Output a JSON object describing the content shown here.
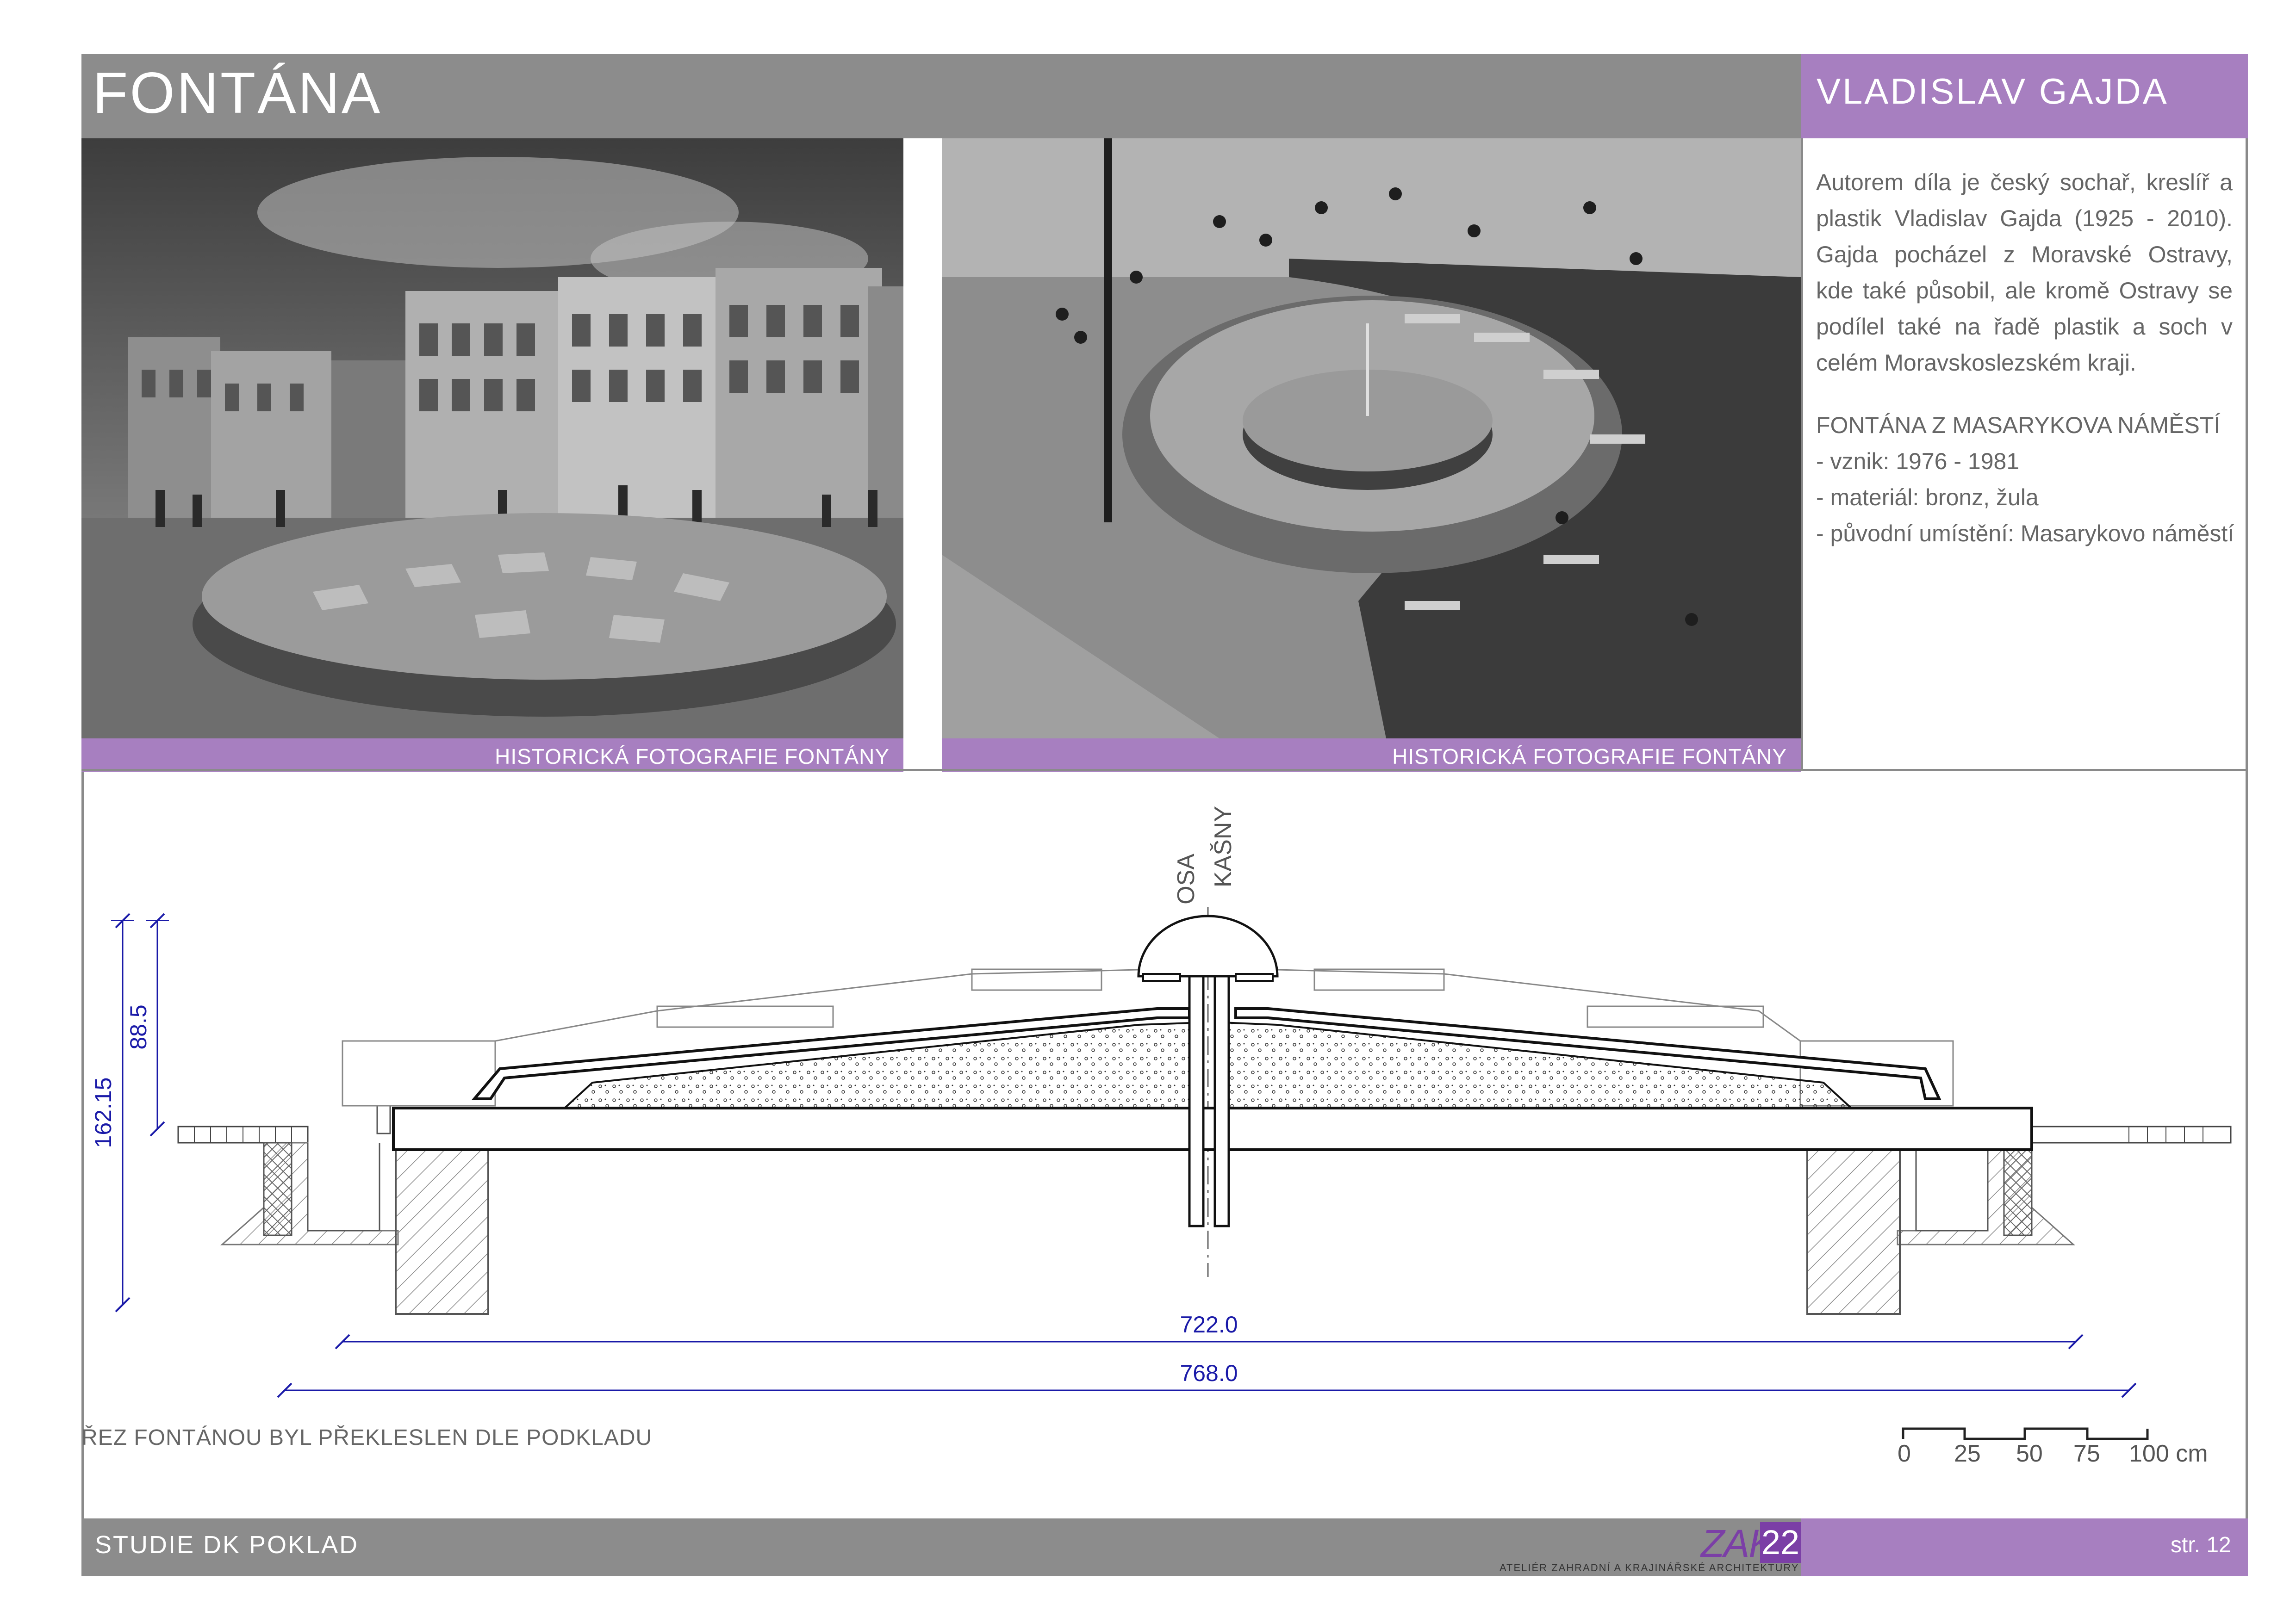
{
  "header": {
    "title": "FONTÁNA",
    "author": "VLADISLAV GAJDA"
  },
  "photos": [
    {
      "caption": "HISTORICKÁ FOTOGRAFIE FONTÁNY"
    },
    {
      "caption": "HISTORICKÁ FOTOGRAFIE FONTÁNY"
    }
  ],
  "side_panel": {
    "bio": "Autorem díla je český sochař, kreslíř a plastik Vladislav Gajda (1925 - 2010). Gajda pocházel z Moravské Ostravy, kde také působil, ale kromě Ostravy se podílel také na řadě plastik a soch v celém Moravskoslezském kraji.",
    "facts_title": "FONTÁNA Z MASARYKOVA NÁMĚSTÍ",
    "facts": [
      "- vznik: 1976 - 1981",
      "- materiál: bronz, žula",
      "- původní umístění: Masarykovo náměstí"
    ]
  },
  "drawing": {
    "axis_label_1": "OSA",
    "axis_label_2": "KAŠNY",
    "dim_total_height": "162.15",
    "dim_upper_height": "88.5",
    "dim_inner_width": "722.0",
    "dim_outer_width": "768.0",
    "note": "ŘEZ FONTÁNOU BYL PŘEKLESLEN DLE  PODKLADU",
    "scale_labels": [
      "0",
      "25",
      "50",
      "75",
      "100 cm"
    ]
  },
  "footer": {
    "project": "STUDIE DK POKLAD",
    "logo_text": "ZAKA",
    "logo_number": "22",
    "logo_subtitle": "ATELIÉR ZAHRADNÍ A KRAJINÁŘSKÉ ARCHITEKTURY",
    "page": "str. 12"
  },
  "colors": {
    "accent_purple": "#a77fc0",
    "header_gray": "#8c8c8c",
    "dimension_blue": "#1a1aa8"
  }
}
